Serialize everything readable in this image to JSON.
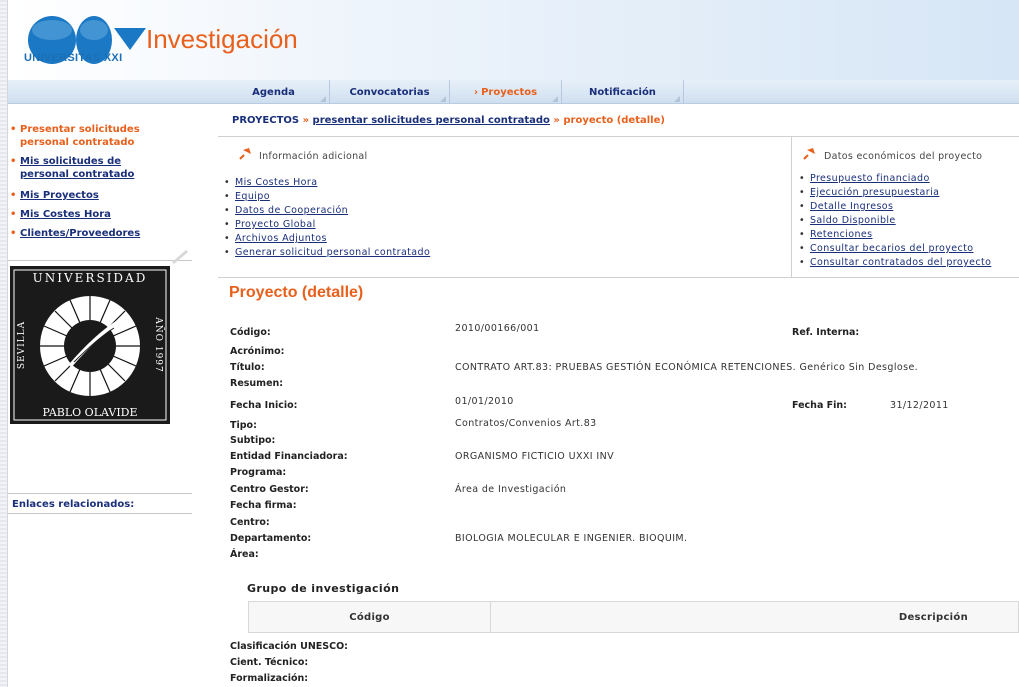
{
  "brand": {
    "logo_text": "UNIVERSITAS XXI",
    "title": "Investigación",
    "colors": {
      "accent": "#e8601c",
      "link": "#1a2f7a",
      "logo_blue": "#1b6fb5"
    }
  },
  "nav": {
    "tabs": [
      {
        "label": "Agenda",
        "active": false
      },
      {
        "label": "Convocatorias",
        "active": false
      },
      {
        "label": "Proyectos",
        "active": true
      },
      {
        "label": "Notificación",
        "active": false
      }
    ]
  },
  "sidebar": {
    "links": [
      {
        "label": "Presentar solicitudes personal contratado",
        "current": true
      },
      {
        "label": "Mis solicitudes de personal contratado",
        "current": false
      },
      {
        "label": "Mis Proyectos",
        "current": false
      },
      {
        "label": "Mis Costes Hora",
        "current": false
      },
      {
        "label": "Clientes/Proveedores",
        "current": false
      }
    ],
    "seal": {
      "top": "UNIVERSIDAD",
      "left": "SEVILLA",
      "right": "AÑO 1997",
      "bottom": "PABLO OLAVIDE"
    },
    "related_label": "Enlaces relacionados:"
  },
  "breadcrumb": {
    "root": "PROYECTOS",
    "separator": "»",
    "link": "presentar solicitudes personal contratado",
    "current": "proyecto (detalle)"
  },
  "info_adicional": {
    "title": "Información adicional",
    "icon": "pin-icon",
    "links": [
      "Mis Costes Hora",
      "Equipo",
      "Datos de Cooperación",
      "Proyecto Global",
      "Archivos Adjuntos",
      "Generar solicitud personal contratado"
    ]
  },
  "datos_economicos": {
    "title": "Datos económicos del proyecto",
    "icon": "pin-icon",
    "links": [
      "Presupuesto financiado",
      "Ejecución presupuestaria",
      "Detalle Ingresos",
      "Saldo Disponible",
      "Retenciones",
      "Consultar becarios del proyecto",
      "Consultar contratados del proyecto"
    ]
  },
  "detalle": {
    "heading": "Proyecto (detalle)",
    "fields": {
      "codigo": {
        "label": "Código:",
        "value": "2010/00166/001"
      },
      "ref_interna": {
        "label": "Ref. Interna:",
        "value": ""
      },
      "acronimo": {
        "label": "Acrónimo:",
        "value": ""
      },
      "titulo": {
        "label": "Título:",
        "value": "CONTRATO ART.83: PRUEBAS GESTIÓN ECONÓMICA RETENCIONES. Genérico Sin Desglose."
      },
      "resumen": {
        "label": "Resumen:",
        "value": ""
      },
      "fecha_inicio": {
        "label": "Fecha Inicio:",
        "value": "01/01/2010"
      },
      "fecha_fin": {
        "label": "Fecha Fin:",
        "value": "31/12/2011"
      },
      "tipo": {
        "label": "Tipo:",
        "value": "Contratos/Convenios Art.83"
      },
      "subtipo": {
        "label": "Subtipo:",
        "value": ""
      },
      "entidad": {
        "label": "Entidad Financiadora:",
        "value": "ORGANISMO FICTICIO UXXI INV"
      },
      "programa": {
        "label": "Programa:",
        "value": ""
      },
      "centro_gestor": {
        "label": "Centro Gestor:",
        "value": "Área de Investigación"
      },
      "fecha_firma": {
        "label": "Fecha firma:",
        "value": ""
      },
      "centro": {
        "label": "Centro:",
        "value": ""
      },
      "departamento": {
        "label": "Departamento:",
        "value": "BIOLOGIA MOLECULAR E INGENIER. BIOQUIM."
      },
      "area": {
        "label": "Área:",
        "value": ""
      }
    },
    "grupo": {
      "title": "Grupo de investigación",
      "columns": [
        "Código",
        "Descripción"
      ]
    },
    "extra_fields": {
      "unesco": {
        "label": "Clasificación UNESCO:"
      },
      "cient": {
        "label": "Cient. Técnico:"
      },
      "formalizacion": {
        "label": "Formalización:"
      }
    }
  }
}
